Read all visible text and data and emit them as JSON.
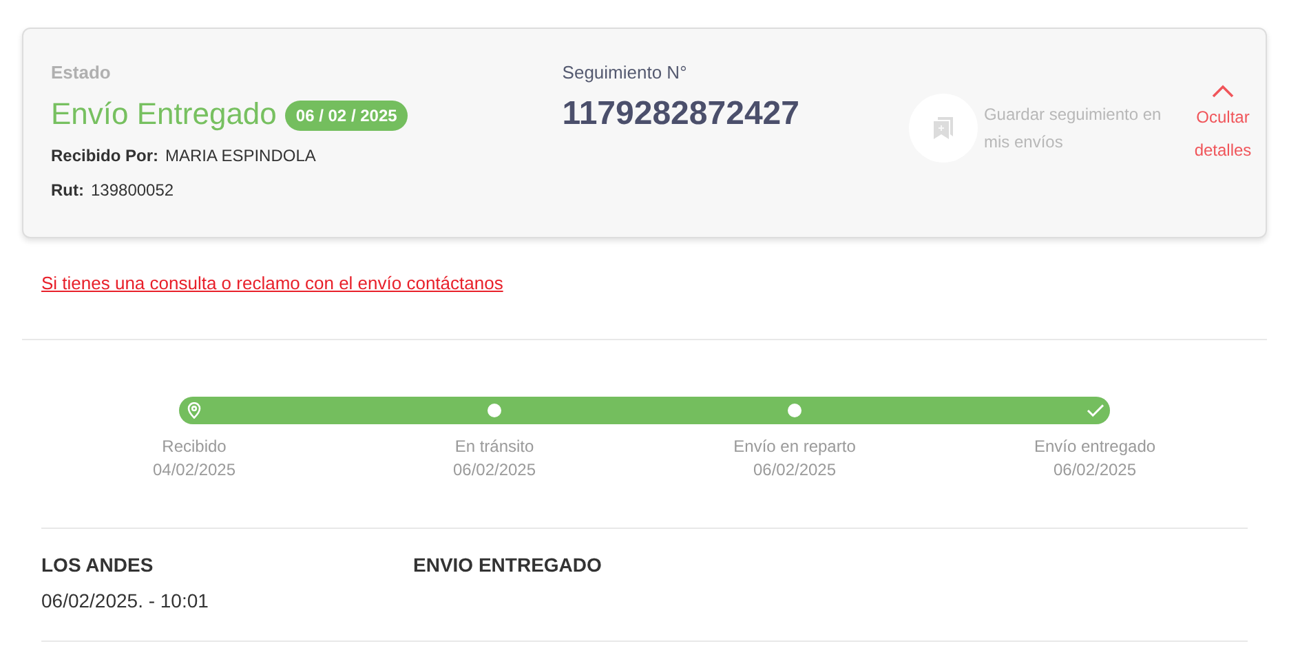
{
  "summary": {
    "status_label": "Estado",
    "status": "Envío Entregado",
    "status_date": "06 / 02 / 2025",
    "received_by_label": "Recibido Por:",
    "received_by": "MARIA ESPINDOLA",
    "rut_label": "Rut:",
    "rut": "139800052",
    "tracking_label": "Seguimiento N°",
    "tracking_number": "1179282872427",
    "save_text": "Guardar seguimiento en mis envíos",
    "toggle_label": "Ocultar detalles",
    "expanded": true
  },
  "contact_link": "Si tienes una consulta o reclamo con el envío contáctanos",
  "progress": {
    "level": 1,
    "steps": [
      {
        "kind": "pin",
        "label": "Recibido",
        "date": "04/02/2025"
      },
      {
        "kind": "dot",
        "label": "En tránsito",
        "date": "06/02/2025"
      },
      {
        "kind": "dot",
        "label": "Envío en reparto",
        "date": "06/02/2025"
      },
      {
        "kind": "check",
        "label": "Envío entregado",
        "date": "06/02/2025"
      }
    ]
  },
  "events": [
    {
      "place": "LOS ANDES",
      "datetime": "06/02/2025. - 10:01",
      "description": "ENVIO ENTREGADO"
    }
  ]
}
